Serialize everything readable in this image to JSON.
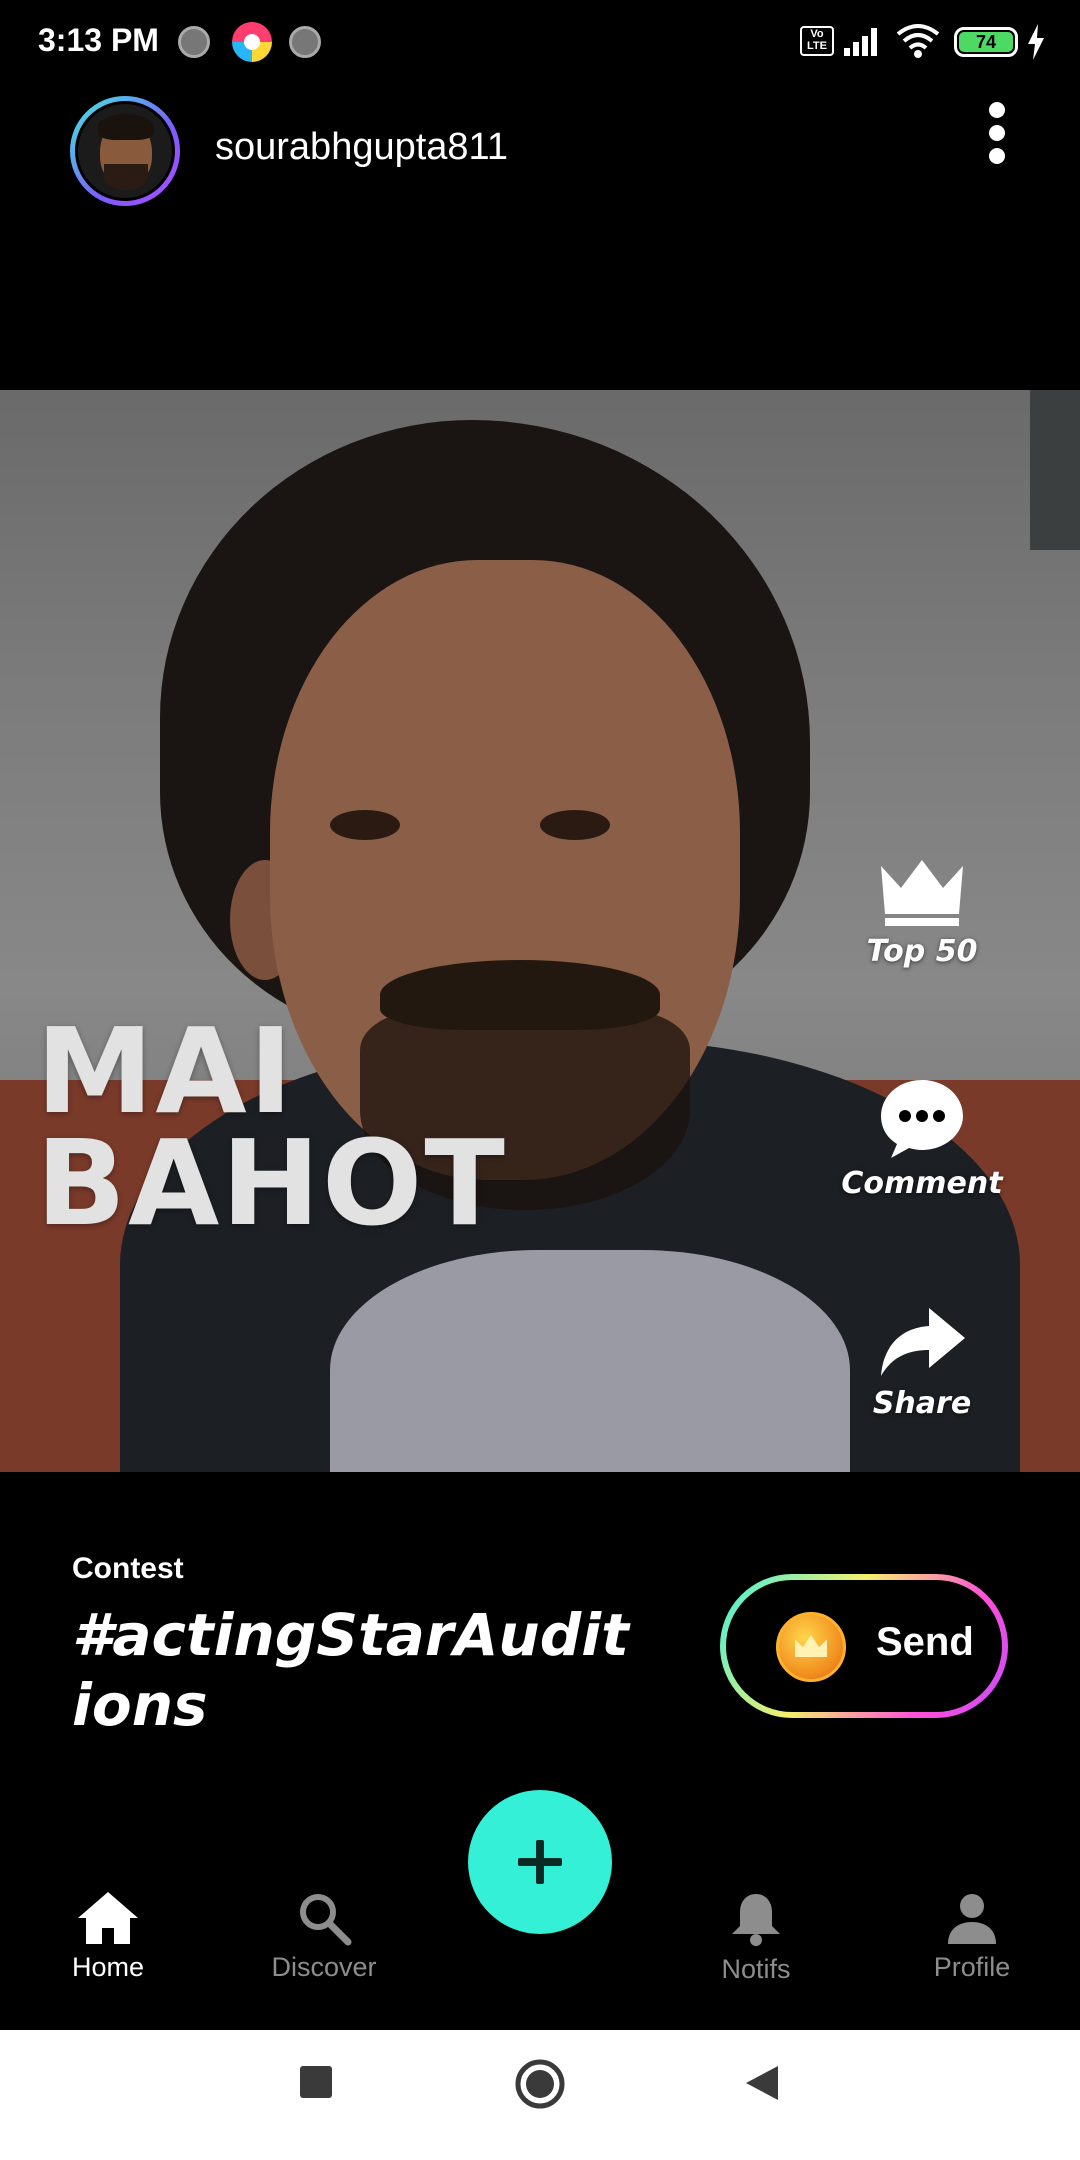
{
  "status_bar": {
    "time": "3:13 PM",
    "battery": "74",
    "volte": "Vo LTE"
  },
  "header": {
    "username": "sourabhgupta811"
  },
  "video": {
    "caption_line1": "MAI",
    "caption_line2": "BAHOT"
  },
  "actions": {
    "top50_label": "Top 50",
    "comment_label": "Comment",
    "share_label": "Share"
  },
  "contest": {
    "label": "Contest",
    "tag": "#actingStarAuditions"
  },
  "send_button": {
    "label": "Send"
  },
  "nav": {
    "home": "Home",
    "discover": "Discover",
    "notifs": "Notifs",
    "profile": "Profile"
  },
  "colors": {
    "accent": "#34f0d6",
    "background": "#000000",
    "battery": "#4cd964"
  }
}
